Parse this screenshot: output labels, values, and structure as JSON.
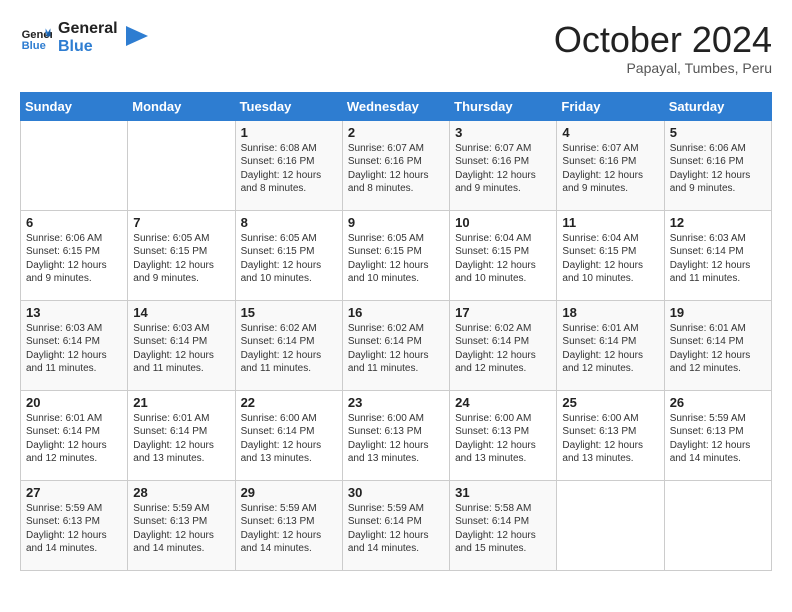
{
  "header": {
    "logo_general": "General",
    "logo_blue": "Blue",
    "month_title": "October 2024",
    "location": "Papayal, Tumbes, Peru"
  },
  "days_of_week": [
    "Sunday",
    "Monday",
    "Tuesday",
    "Wednesday",
    "Thursday",
    "Friday",
    "Saturday"
  ],
  "weeks": [
    [
      {
        "day": "",
        "info": ""
      },
      {
        "day": "",
        "info": ""
      },
      {
        "day": "1",
        "info": "Sunrise: 6:08 AM\nSunset: 6:16 PM\nDaylight: 12 hours and 8 minutes."
      },
      {
        "day": "2",
        "info": "Sunrise: 6:07 AM\nSunset: 6:16 PM\nDaylight: 12 hours and 8 minutes."
      },
      {
        "day": "3",
        "info": "Sunrise: 6:07 AM\nSunset: 6:16 PM\nDaylight: 12 hours and 9 minutes."
      },
      {
        "day": "4",
        "info": "Sunrise: 6:07 AM\nSunset: 6:16 PM\nDaylight: 12 hours and 9 minutes."
      },
      {
        "day": "5",
        "info": "Sunrise: 6:06 AM\nSunset: 6:16 PM\nDaylight: 12 hours and 9 minutes."
      }
    ],
    [
      {
        "day": "6",
        "info": "Sunrise: 6:06 AM\nSunset: 6:15 PM\nDaylight: 12 hours and 9 minutes."
      },
      {
        "day": "7",
        "info": "Sunrise: 6:05 AM\nSunset: 6:15 PM\nDaylight: 12 hours and 9 minutes."
      },
      {
        "day": "8",
        "info": "Sunrise: 6:05 AM\nSunset: 6:15 PM\nDaylight: 12 hours and 10 minutes."
      },
      {
        "day": "9",
        "info": "Sunrise: 6:05 AM\nSunset: 6:15 PM\nDaylight: 12 hours and 10 minutes."
      },
      {
        "day": "10",
        "info": "Sunrise: 6:04 AM\nSunset: 6:15 PM\nDaylight: 12 hours and 10 minutes."
      },
      {
        "day": "11",
        "info": "Sunrise: 6:04 AM\nSunset: 6:15 PM\nDaylight: 12 hours and 10 minutes."
      },
      {
        "day": "12",
        "info": "Sunrise: 6:03 AM\nSunset: 6:14 PM\nDaylight: 12 hours and 11 minutes."
      }
    ],
    [
      {
        "day": "13",
        "info": "Sunrise: 6:03 AM\nSunset: 6:14 PM\nDaylight: 12 hours and 11 minutes."
      },
      {
        "day": "14",
        "info": "Sunrise: 6:03 AM\nSunset: 6:14 PM\nDaylight: 12 hours and 11 minutes."
      },
      {
        "day": "15",
        "info": "Sunrise: 6:02 AM\nSunset: 6:14 PM\nDaylight: 12 hours and 11 minutes."
      },
      {
        "day": "16",
        "info": "Sunrise: 6:02 AM\nSunset: 6:14 PM\nDaylight: 12 hours and 11 minutes."
      },
      {
        "day": "17",
        "info": "Sunrise: 6:02 AM\nSunset: 6:14 PM\nDaylight: 12 hours and 12 minutes."
      },
      {
        "day": "18",
        "info": "Sunrise: 6:01 AM\nSunset: 6:14 PM\nDaylight: 12 hours and 12 minutes."
      },
      {
        "day": "19",
        "info": "Sunrise: 6:01 AM\nSunset: 6:14 PM\nDaylight: 12 hours and 12 minutes."
      }
    ],
    [
      {
        "day": "20",
        "info": "Sunrise: 6:01 AM\nSunset: 6:14 PM\nDaylight: 12 hours and 12 minutes."
      },
      {
        "day": "21",
        "info": "Sunrise: 6:01 AM\nSunset: 6:14 PM\nDaylight: 12 hours and 13 minutes."
      },
      {
        "day": "22",
        "info": "Sunrise: 6:00 AM\nSunset: 6:14 PM\nDaylight: 12 hours and 13 minutes."
      },
      {
        "day": "23",
        "info": "Sunrise: 6:00 AM\nSunset: 6:13 PM\nDaylight: 12 hours and 13 minutes."
      },
      {
        "day": "24",
        "info": "Sunrise: 6:00 AM\nSunset: 6:13 PM\nDaylight: 12 hours and 13 minutes."
      },
      {
        "day": "25",
        "info": "Sunrise: 6:00 AM\nSunset: 6:13 PM\nDaylight: 12 hours and 13 minutes."
      },
      {
        "day": "26",
        "info": "Sunrise: 5:59 AM\nSunset: 6:13 PM\nDaylight: 12 hours and 14 minutes."
      }
    ],
    [
      {
        "day": "27",
        "info": "Sunrise: 5:59 AM\nSunset: 6:13 PM\nDaylight: 12 hours and 14 minutes."
      },
      {
        "day": "28",
        "info": "Sunrise: 5:59 AM\nSunset: 6:13 PM\nDaylight: 12 hours and 14 minutes."
      },
      {
        "day": "29",
        "info": "Sunrise: 5:59 AM\nSunset: 6:13 PM\nDaylight: 12 hours and 14 minutes."
      },
      {
        "day": "30",
        "info": "Sunrise: 5:59 AM\nSunset: 6:14 PM\nDaylight: 12 hours and 14 minutes."
      },
      {
        "day": "31",
        "info": "Sunrise: 5:58 AM\nSunset: 6:14 PM\nDaylight: 12 hours and 15 minutes."
      },
      {
        "day": "",
        "info": ""
      },
      {
        "day": "",
        "info": ""
      }
    ]
  ]
}
